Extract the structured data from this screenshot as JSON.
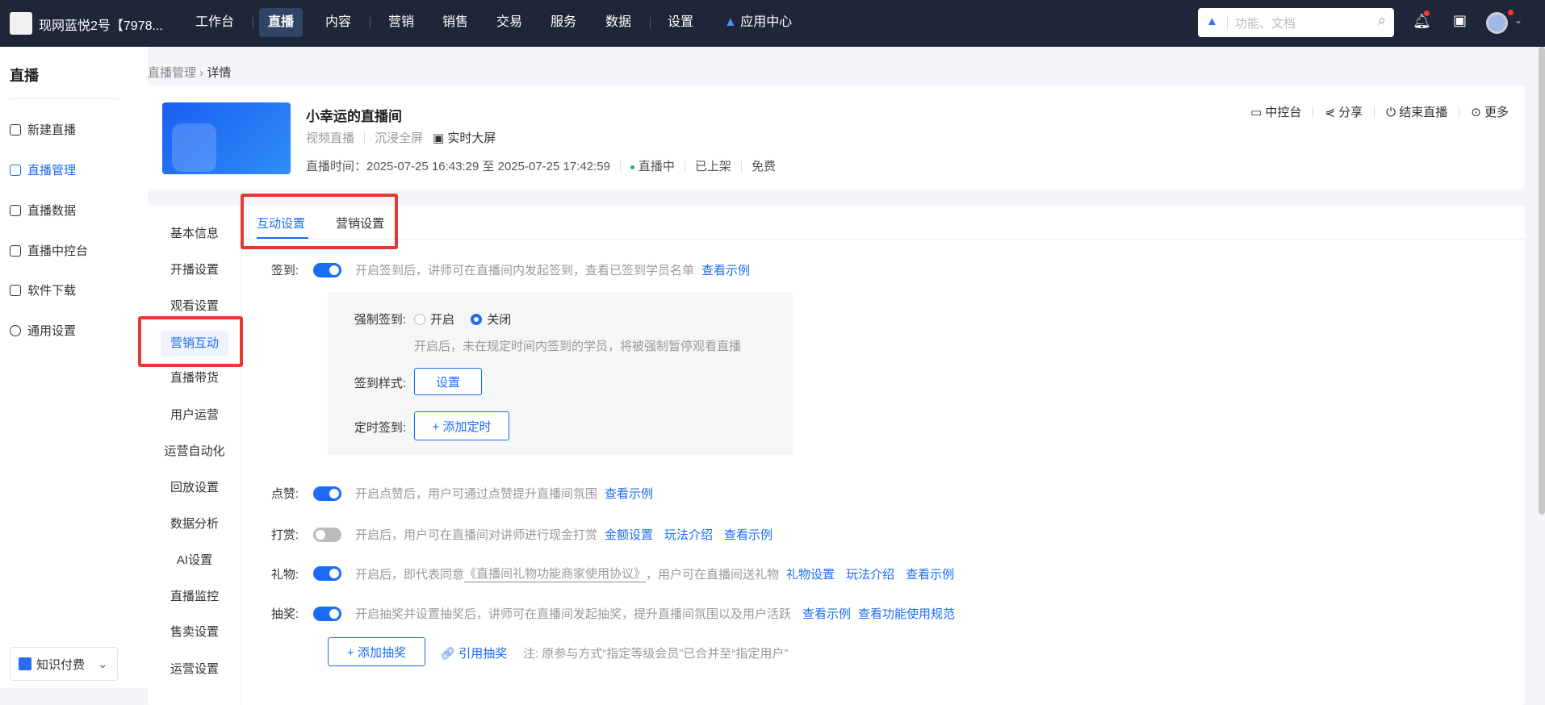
{
  "topbar": {
    "shop_name": "现网蓝悦2号【7978...",
    "nav": [
      "工作台",
      "直播",
      "内容",
      "营销",
      "销售",
      "交易",
      "服务",
      "数据",
      "设置",
      "应用中心"
    ],
    "active": "直播",
    "search_placeholder": "功能、文档"
  },
  "sidebar": {
    "title": "直播",
    "items": [
      "新建直播",
      "直播管理",
      "直播数据",
      "直播中控台",
      "软件下载",
      "通用设置"
    ],
    "active": "直播管理",
    "bottom": "知识付费"
  },
  "breadcrumb": [
    "直播管理",
    "详情"
  ],
  "live": {
    "title": "小幸运的直播间",
    "type": "视频直播",
    "mode": "沉浸全屏",
    "screen": "实时大屏",
    "time_label": "直播时间：2025-07-25 16:43:29 至 2025-07-25 17:42:59",
    "status": "直播中",
    "shelf": "已上架",
    "price": "免费",
    "actions": [
      "中控台",
      "分享",
      "结束直播",
      "更多"
    ]
  },
  "subnav": {
    "items": [
      "基本信息",
      "开播设置",
      "观看设置",
      "营销互动",
      "直播带货",
      "用户运营",
      "运营自动化",
      "回放设置",
      "数据分析",
      "AI设置",
      "直播监控",
      "售卖设置",
      "运营设置"
    ],
    "active": "营销互动"
  },
  "tabs": {
    "items": [
      "互动设置",
      "营销设置"
    ],
    "active": "互动设置"
  },
  "settings": {
    "signin": {
      "label": "签到:",
      "on": true,
      "desc": "开启签到后，讲师可在直播间内发起签到，查看已签到学员名单",
      "link": "查看示例",
      "force_label": "强制签到:",
      "force_opts": [
        "开启",
        "关闭"
      ],
      "force_selected": "关闭",
      "force_hint": "开启后，未在规定时间内签到的学员，将被强制暂停观看直播",
      "style_label": "签到样式:",
      "style_btn": "设置",
      "timer_label": "定时签到:",
      "timer_btn": "+ 添加定时"
    },
    "like": {
      "label": "点赞:",
      "on": true,
      "desc": "开启点赞后，用户可通过点赞提升直播间氛围",
      "links": [
        "查看示例"
      ]
    },
    "reward": {
      "label": "打赏:",
      "on": false,
      "desc": "开启后，用户可在直播间对讲师进行现金打赏",
      "links": [
        "金额设置",
        "玩法介绍",
        "查看示例"
      ]
    },
    "gift": {
      "label": "礼物:",
      "on": true,
      "desc1": "开启后，即代表同意",
      "agreement": "《直播间礼物功能商家使用协议》",
      "desc2": "，用户可在直播间送礼物",
      "links": [
        "礼物设置",
        "玩法介绍",
        "查看示例"
      ]
    },
    "lottery": {
      "label": "抽奖:",
      "on": true,
      "desc": "开启抽奖并设置抽奖后，讲师可在直播间发起抽奖，提升直播间氛围以及用户活跃",
      "links": [
        "查看示例",
        "查看功能使用规范"
      ],
      "add_btn": "+ 添加抽奖",
      "cite": "引用抽奖",
      "note": "注: 原参与方式“指定等级会员”已合并至“指定用户”"
    }
  }
}
